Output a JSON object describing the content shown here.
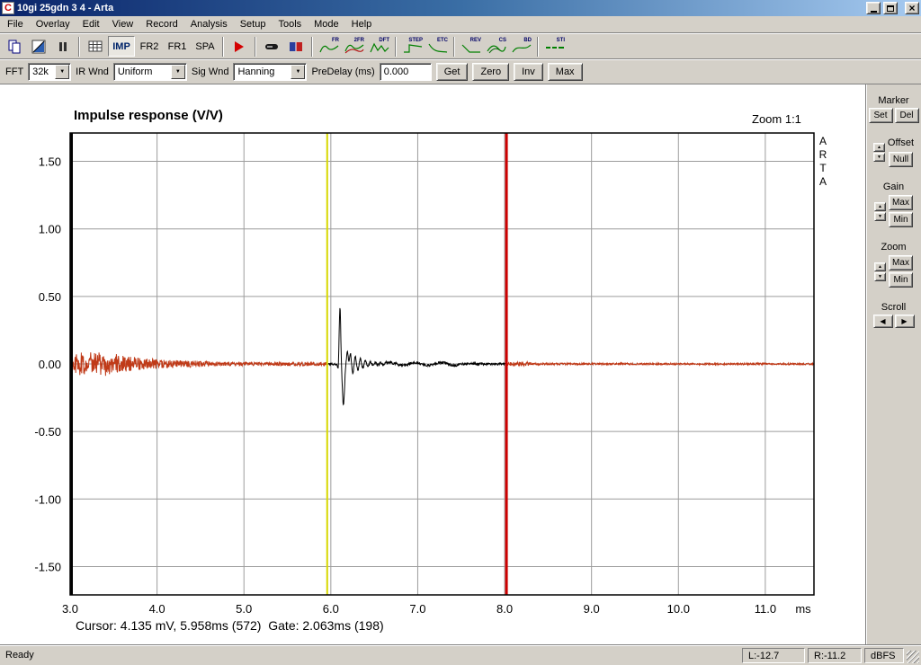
{
  "window": {
    "title": "10gi 25gdn 3 4 - Arta"
  },
  "menu": {
    "items": [
      "File",
      "Overlay",
      "Edit",
      "View",
      "Record",
      "Analysis",
      "Setup",
      "Tools",
      "Mode",
      "Help"
    ]
  },
  "toolbar": {
    "mode_buttons": [
      "IMP",
      "FR2",
      "FR1",
      "SPA"
    ],
    "chart_buttons": [
      "FR",
      "2FR",
      "DFT",
      "STEP",
      "ETC",
      "REV",
      "CS",
      "BD",
      "STI"
    ]
  },
  "controls": {
    "fft": {
      "label": "FFT",
      "value": "32k"
    },
    "ir_wnd": {
      "label": "IR Wnd",
      "value": "Uniform"
    },
    "sig_wnd": {
      "label": "Sig Wnd",
      "value": "Hanning"
    },
    "predelay": {
      "label": "PreDelay (ms)",
      "value": "0.000"
    },
    "get": "Get",
    "zero": "Zero",
    "inv": "Inv",
    "max": "Max"
  },
  "chart": {
    "title": "Impulse response (V/V)",
    "zoom": "Zoom 1:1",
    "watermark": "A\nR\nT\nA",
    "y_ticks": [
      "1.50",
      "1.00",
      "0.50",
      "0.00",
      "-0.50",
      "-1.00",
      "-1.50"
    ],
    "x_ticks": [
      "3.0",
      "4.0",
      "5.0",
      "6.0",
      "7.0",
      "8.0",
      "9.0",
      "10.0",
      "11.0"
    ],
    "x_unit": "ms",
    "status": "Cursor: 4.135 mV, 5.958ms (572)  Gate: 2.063ms (198)"
  },
  "chart_data": {
    "type": "line",
    "title": "Impulse response (V/V)",
    "x_unit": "ms",
    "x_ticks": [
      3.0,
      4.0,
      5.0,
      6.0,
      7.0,
      8.0,
      9.0,
      10.0,
      11.0
    ],
    "y_ticks": [
      1.5,
      1.0,
      0.5,
      0.0,
      -0.5,
      -1.0,
      -1.5
    ],
    "x_range": [
      3.0,
      11.56
    ],
    "y_range": [
      -1.71,
      1.71
    ],
    "zoom": "1:1",
    "cursor": {
      "value_mV": 4.135,
      "time_ms": 5.958,
      "sample": 572
    },
    "gate": {
      "length_ms": 2.063,
      "samples": 198,
      "end_ms": 8.021
    },
    "impulse": {
      "peak_ms": 6.105,
      "peak_v": 0.42,
      "trough_ms": 6.145,
      "trough_v": -0.31
    },
    "noise_description": "low-level noise band ~±0.1 V at 3.0-3.5 ms decaying to ~±0.02 V; damped ringing after main impulse until ~6.8 ms; near-flat trace after gate line",
    "series_colors": {
      "outside_gate": "#c03a18",
      "inside_gate": "#000000"
    }
  },
  "panel": {
    "marker": {
      "label": "Marker",
      "set": "Set",
      "del": "Del"
    },
    "offset": {
      "label": "Offset",
      "null": "Null"
    },
    "gain": {
      "label": "Gain",
      "max": "Max",
      "min": "Min"
    },
    "zoom": {
      "label": "Zoom",
      "max": "Max",
      "min": "Min"
    },
    "scroll": {
      "label": "Scroll"
    }
  },
  "statusbar": {
    "ready": "Ready",
    "left": "L:-12.7",
    "right": "R:-11.2",
    "unit": "dBFS"
  },
  "colors": {
    "titlebar": "#0a246a",
    "chrome": "#d4d0c8",
    "cursor_line": "#d8d800",
    "gate_line": "#cc0000",
    "grid": "#9c9c9c"
  }
}
